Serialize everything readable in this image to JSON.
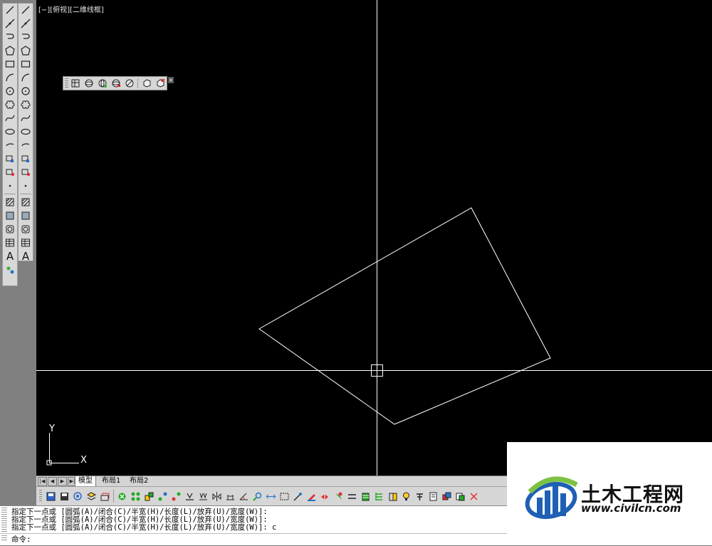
{
  "viewport": {
    "label": "[−][俯视][二维线框]"
  },
  "tabs": {
    "items": [
      {
        "label": "模型"
      },
      {
        "label": "布局1"
      },
      {
        "label": "布局2"
      }
    ]
  },
  "command": {
    "history": [
      "指定下一点或 [圆弧(A)/闭合(C)/半宽(H)/长度(L)/放弃(U)/宽度(W)]:",
      "指定下一点或 [圆弧(A)/闭合(C)/半宽(H)/长度(L)/放弃(U)/宽度(W)]:",
      "指定下一点或 [圆弧(A)/闭合(C)/半宽(H)/长度(L)/放弃(U)/宽度(W)]: c"
    ],
    "prompt": "命令:"
  },
  "ucs": {
    "y_label": "Y",
    "x_label": "X"
  },
  "left_palette": {
    "icons": [
      "line-icon",
      "construction-line-icon",
      "polyline-icon",
      "polygon-icon",
      "rectangle-icon",
      "arc-icon",
      "circle-icon",
      "revision-cloud-icon",
      "spline-icon",
      "ellipse-icon",
      "ellipse-arc-icon",
      "insert-block-icon",
      "make-block-icon",
      "point-icon",
      "hatch-icon",
      "gradient-icon",
      "region-icon",
      "table-icon",
      "multiline-text-icon",
      "add-selected-icon"
    ],
    "text_tool": "A"
  },
  "watermark": {
    "title": "土木工程网",
    "url": "www.civilcn.com"
  },
  "colors": {
    "canvas": "#000000",
    "crosshair": "#ffffff",
    "geometry": "#ffffff",
    "ui": "#d6d6d6",
    "logo_blue": "#1f5fb4",
    "logo_green": "#7cc242"
  }
}
